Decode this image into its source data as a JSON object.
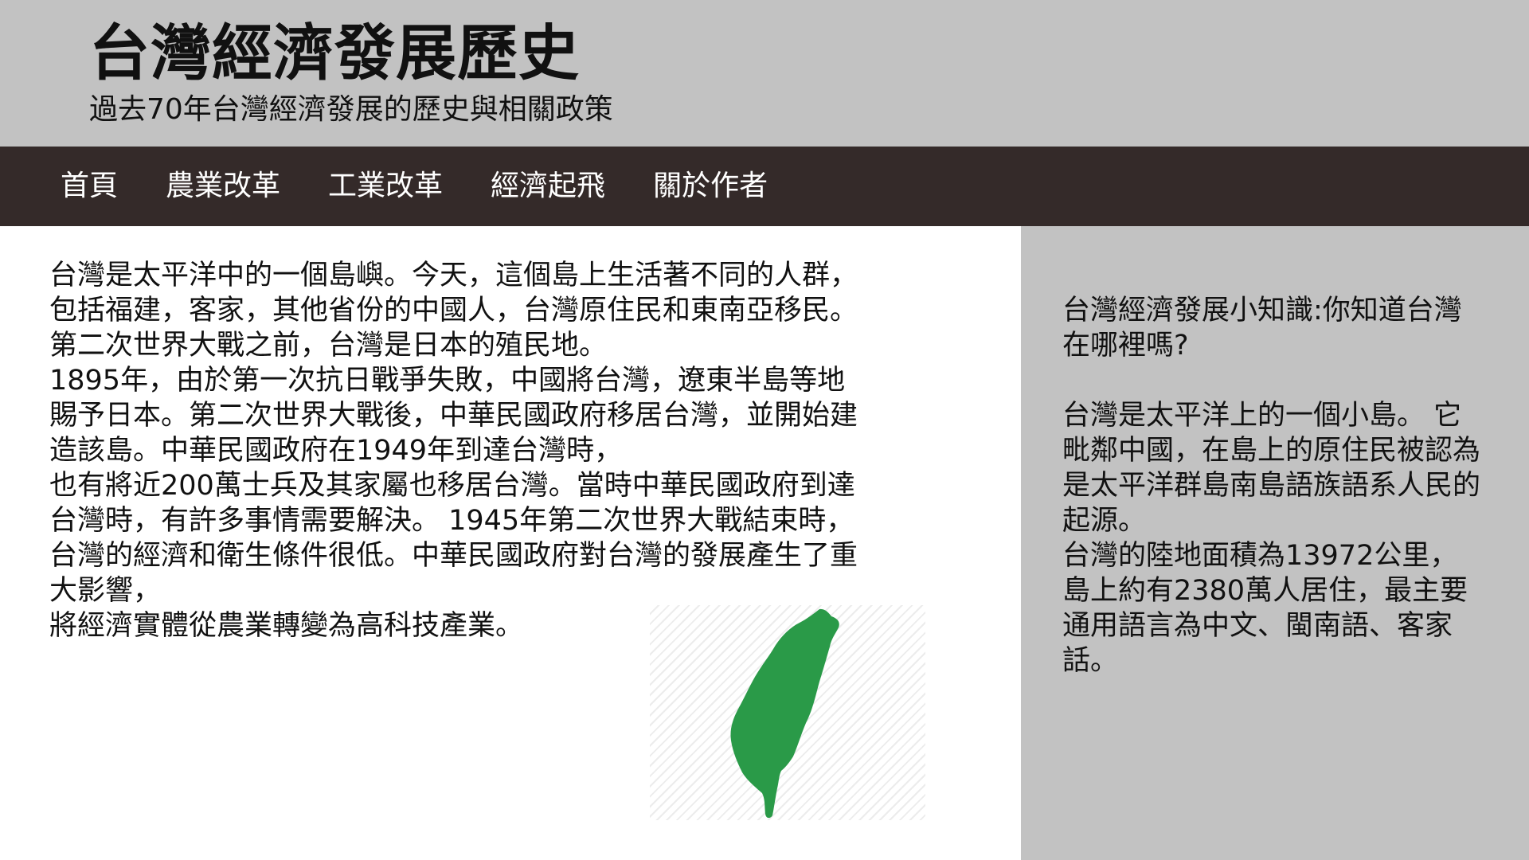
{
  "header": {
    "title": "台灣經濟發展歷史",
    "subtitle": "過去70年台灣經濟發展的歷史與相關政策"
  },
  "nav": {
    "items": [
      {
        "label": "首頁"
      },
      {
        "label": "農業改革"
      },
      {
        "label": "工業改革"
      },
      {
        "label": "經濟起飛"
      },
      {
        "label": "關於作者"
      }
    ]
  },
  "main": {
    "paragraphs": [
      " 台灣是太平洋中的一個島嶼。今天，這個島上生活著不同的人群，包括福建，客家，其他省份的中國人，台灣原住民和東南亞移民。第二次世界大戰之前，台灣是日本的殖民地。",
      "1895年，由於第一次抗日戰爭失敗，中國將台灣，遼東半島等地賜予日本。第二次世界大戰後，中華民國政府移居台灣，並開始建造該島。中華民國政府在1949年到達台灣時，",
      "也有將近200萬士兵及其家屬也移居台灣。當時中華民國政府到達台灣時，有許多事情需要解決。 1945年第二次世界大戰結束時，台灣的經濟和衛生條件很低。中華民國政府對台灣的發展產生了重大影響，",
      "將經濟實體從農業轉變為高科技產業。"
    ],
    "map": {
      "icon": "taiwan-map-icon",
      "fill_color": "#2a9a48"
    }
  },
  "aside": {
    "heading": "台灣經濟發展小知識:你知道台灣在哪裡嗎?",
    "paragraphs": [
      "台灣是太平洋上的一個小島。 它毗鄰中國，在島上的原住民被認為是太平洋群島南島語族語系人民的起源。",
      " 台灣的陸地面積為13972公里，島上約有2380萬人居住，最主要通用語言為中文、閩南語、客家話。"
    ]
  },
  "colors": {
    "header_bg": "#c2c2c2",
    "nav_bg": "#342a29",
    "aside_bg": "#c2c2c2",
    "map_green": "#2a9a48"
  }
}
